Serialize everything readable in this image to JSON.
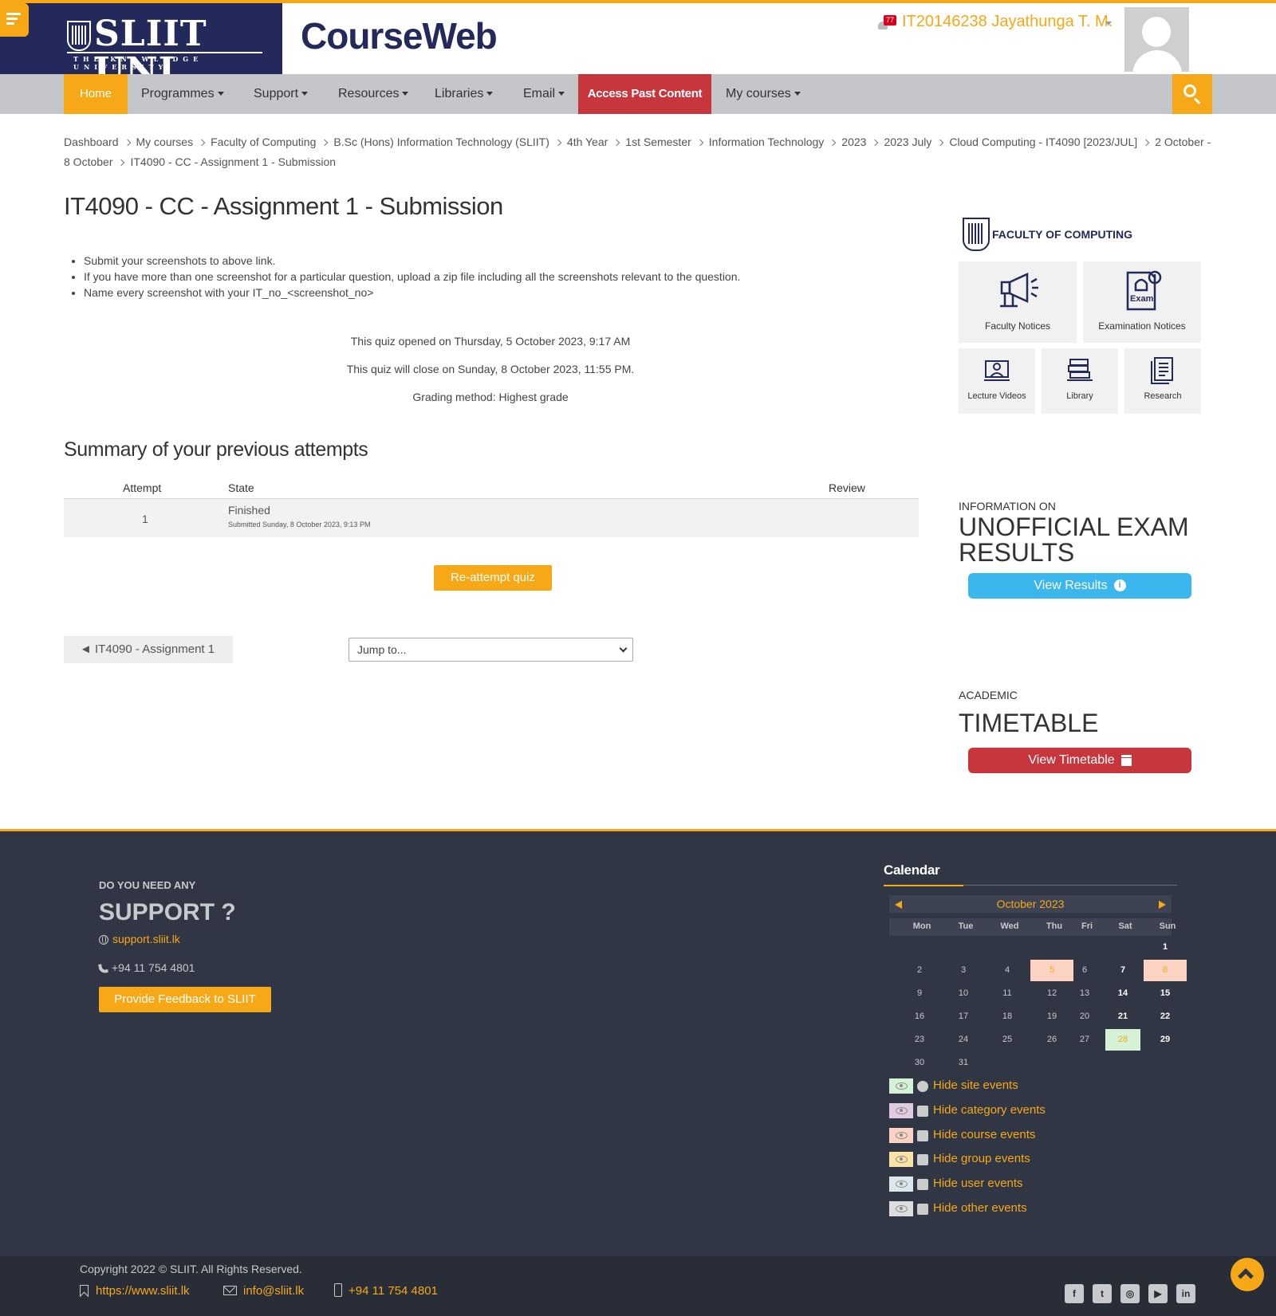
{
  "header": {
    "logo_text": "SLIIT UNI",
    "logo_tagline": "THE KNOWLEDGE UNIVERSITY",
    "brand": "CourseWeb",
    "user_name": "IT20146238 Jayathunga T. M.",
    "notification_count": "77",
    "accent_color": "#f7a816",
    "navy_color": "#23295a"
  },
  "nav": {
    "home": "Home",
    "programmes": "Programmes",
    "support": "Support",
    "resources": "Resources",
    "libraries": "Libraries",
    "email": "Email",
    "access_past": "Access Past Content",
    "my_courses": "My courses"
  },
  "breadcrumb": [
    "Dashboard",
    "My courses",
    "Faculty of Computing",
    "B.Sc (Hons) Information Technology (SLIIT)",
    "4th Year",
    "1st Semester",
    "Information Technology",
    "2023",
    "2023 July",
    "Cloud Computing - IT4090 [2023/JUL]",
    "2 October - 8 October",
    "IT4090 - CC - Assignment 1 - Submission"
  ],
  "main": {
    "title": "IT4090 - CC - Assignment 1 - Submission",
    "instructions": [
      "Submit your screenshots to above link.",
      "If you have more than one screenshot for a particular question, upload a zip file including all the screenshots relevant to the question.",
      "Name every screenshot with your IT_no_<screenshot_no>"
    ],
    "opened": "This quiz opened on Thursday, 5 October 2023, 9:17 AM",
    "closes": "This quiz will close on Sunday, 8 October 2023, 11:55 PM.",
    "grading": "Grading method: Highest grade",
    "summary_title": "Summary of your previous attempts",
    "table": {
      "headers": {
        "attempt": "Attempt",
        "state": "State",
        "review": "Review"
      },
      "rows": [
        {
          "attempt": "1",
          "state": "Finished",
          "submitted": "Submitted Sunday, 8 October 2023, 9:13 PM",
          "review": ""
        }
      ]
    },
    "reattempt": "Re-attempt quiz",
    "prev_activity": "IT4090 - Assignment 1",
    "jump_placeholder": "Jump to..."
  },
  "sidebar": {
    "faculty_title": "FACULTY OF COMPUTING",
    "tiles": {
      "faculty_notices": "Faculty Notices",
      "exam_notices": "Examination Notices",
      "lecture_videos": "Lecture Videos",
      "library": "Library",
      "research": "Research"
    },
    "exam_small": "INFORMATION ON",
    "exam_big_1": "UNOFFICIAL EXAM",
    "exam_big_2": "RESULTS",
    "view_results": "View Results",
    "tt_small": "ACADEMIC",
    "tt_big": "TIMETABLE",
    "view_timetable": "View Timetable"
  },
  "footer": {
    "support_small": "DO YOU NEED ANY",
    "support_big": "SUPPORT ?",
    "support_link": "support.sliit.lk",
    "support_phone": "+94 11 754 4801",
    "feedback": "Provide Feedback to SLIIT",
    "calendar_title": "Calendar",
    "calendar_month": "October 2023",
    "calendar_days": [
      "Mon",
      "Tue",
      "Wed",
      "Thu",
      "Fri",
      "Sat",
      "Sun"
    ],
    "calendar_weeks": [
      [
        "",
        "",
        "",
        "",
        "",
        "",
        "1"
      ],
      [
        "2",
        "3",
        "4",
        "5",
        "6",
        "7",
        "8"
      ],
      [
        "9",
        "10",
        "11",
        "12",
        "13",
        "14",
        "15"
      ],
      [
        "16",
        "17",
        "18",
        "19",
        "20",
        "21",
        "22"
      ],
      [
        "23",
        "24",
        "25",
        "26",
        "27",
        "28",
        "29"
      ],
      [
        "30",
        "31",
        "",
        "",
        "",
        "",
        ""
      ]
    ],
    "calendar_highlight_days": [
      "5",
      "8"
    ],
    "calendar_today": "28",
    "events": {
      "site": "Hide site events",
      "category": "Hide category events",
      "course": "Hide course events",
      "group": "Hide group events",
      "user": "Hide user events",
      "other": "Hide other events"
    },
    "event_colors": {
      "site": "#d5f2d6",
      "category": "#e0cbe0",
      "course": "#fdd3c4",
      "group": "#fbe3a8",
      "user": "#dce7ec",
      "other": "#dddddd"
    },
    "copyright": "Copyright 2022 © SLIIT. All Rights Reserved.",
    "website": "https://www.sliit.lk",
    "email": "info@sliit.lk",
    "phone": "+94 11 754 4801",
    "social_icons": [
      "facebook-icon",
      "twitter-icon",
      "instagram-icon",
      "youtube-icon",
      "linkedin-icon"
    ]
  }
}
